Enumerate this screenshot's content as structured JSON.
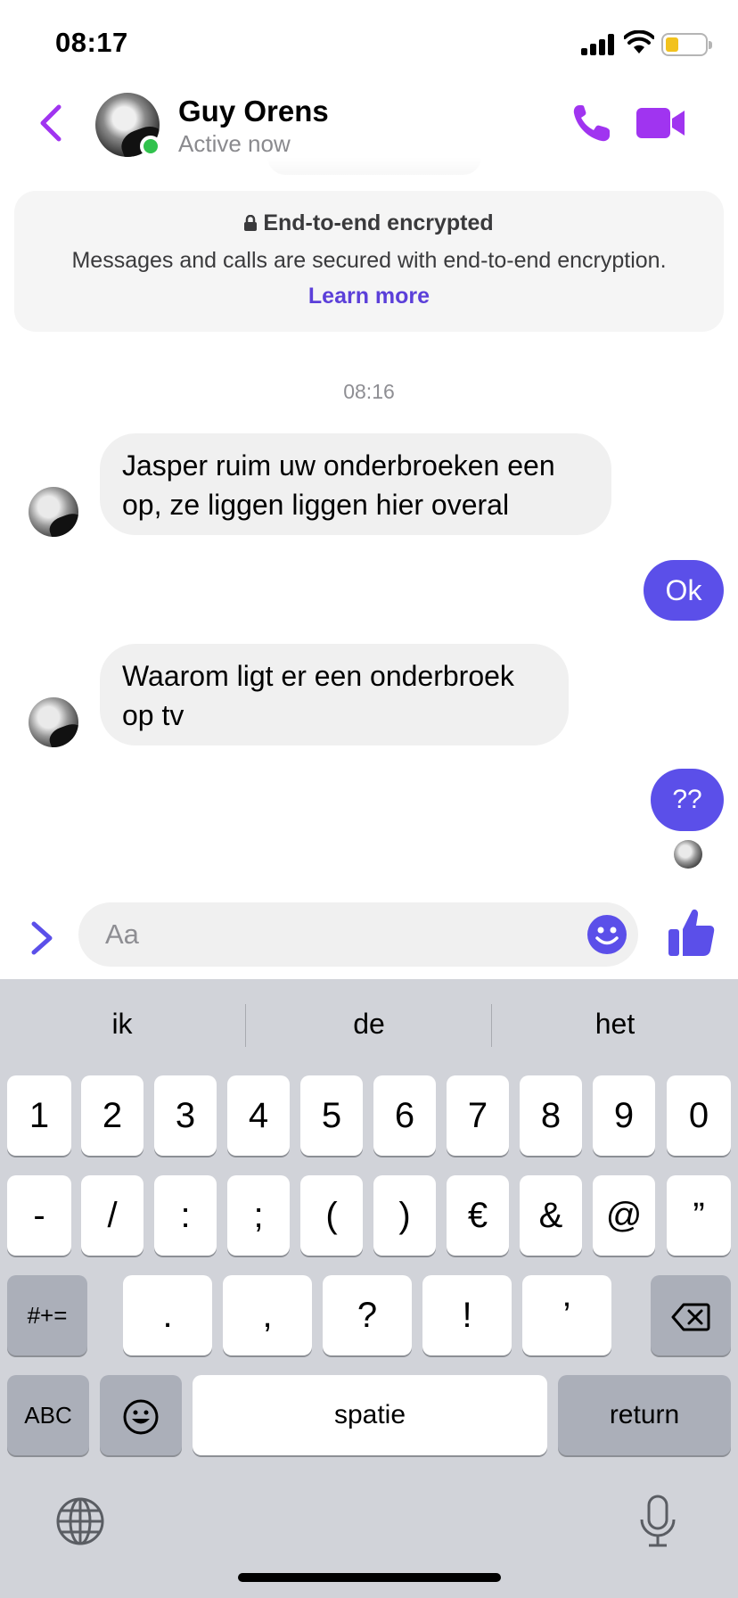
{
  "status_bar": {
    "time": "08:17"
  },
  "header": {
    "contact_name": "Guy Orens",
    "contact_status": "Active now",
    "accent_color": "#a034f0"
  },
  "encryption": {
    "title": "End-to-end encrypted",
    "description": "Messages and calls are secured with end-to-end encryption.",
    "link": "Learn more"
  },
  "conversation": {
    "timestamp": "08:16",
    "messages": [
      {
        "direction": "incoming",
        "lines": [
          "Jasper ruim uw onderbroeken een",
          "op, ze liggen liggen hier overal"
        ]
      },
      {
        "direction": "outgoing",
        "text": "Ok"
      },
      {
        "direction": "incoming",
        "lines": [
          "Waarom ligt er een onderbroek",
          "op tv"
        ]
      },
      {
        "direction": "outgoing",
        "text": "??"
      }
    ],
    "outgoing_color": "#5b4fe9"
  },
  "composer": {
    "placeholder": "Aa"
  },
  "keyboard": {
    "suggestions": [
      "ik",
      "de",
      "het"
    ],
    "row1": [
      "1",
      "2",
      "3",
      "4",
      "5",
      "6",
      "7",
      "8",
      "9",
      "0"
    ],
    "row2": [
      "-",
      "/",
      ":",
      ";",
      "(",
      ")",
      "€",
      "&",
      "@",
      "”"
    ],
    "row3_left": "#+=",
    "row3": [
      ".",
      ",",
      "?",
      "!",
      "’"
    ],
    "abc": "ABC",
    "space": "spatie",
    "return": "return"
  }
}
